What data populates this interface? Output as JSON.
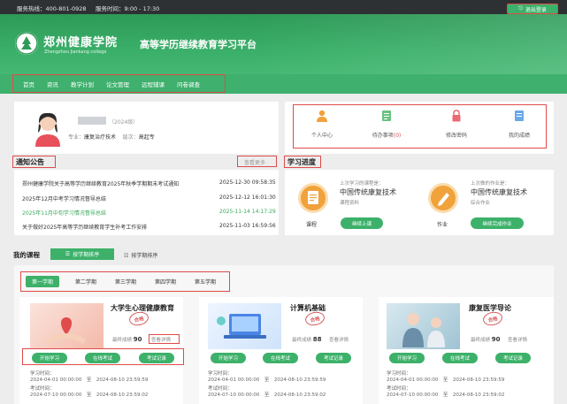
{
  "topbar": {
    "hotline": "服务热线：400-801-0928",
    "service_time": "服务时间：9:00 - 17:30",
    "logout": "退出登录"
  },
  "header": {
    "logo_cn": "郑州健康学院",
    "logo_en": "Zhengzhou Jiankang college",
    "site_title": "高等学历继续教育学习平台"
  },
  "nav": {
    "items": [
      "首页",
      "资讯",
      "教学计划",
      "论文管理",
      "远程辅课",
      "问卷调查"
    ]
  },
  "profile": {
    "grade": "（2024级）",
    "major_label": "专业：",
    "major": "康复治疗技术",
    "level_label": "层次：",
    "level": "高起专"
  },
  "quick_access": [
    {
      "label": "个人中心",
      "icon": "person-icon"
    },
    {
      "label": "待办事项",
      "count": "(0)",
      "icon": "todo-list-icon"
    },
    {
      "label": "修改密码",
      "icon": "lock-icon"
    },
    {
      "label": "我的成绩",
      "icon": "grade-report-icon"
    }
  ],
  "notice": {
    "title": "通知公告",
    "more": "查看更多",
    "items": [
      {
        "text": "郑州健康学院关于高等学历继续教育2025年秋季学期期末考试通知",
        "date": "2025-12-30 09:58:35",
        "highlight": false
      },
      {
        "text": "2025年12月中考学习情况督导总结",
        "date": "2025-12-12 16:01:30",
        "highlight": false
      },
      {
        "text": "2025年11月中旬学习情况督导总结",
        "date": "2025-11-14 14:17:29",
        "highlight": true
      },
      {
        "text": "关于做好2025年高等学历继续教育学生补考工作安排",
        "date": "2025-11-03 16:59:56",
        "highlight": false
      }
    ]
  },
  "progress": {
    "title": "学习进度",
    "course": {
      "last_label": "上次学习的课程是：",
      "name": "中国传统康复技术",
      "sub": "课程资料",
      "circle_label": "课程",
      "button": "继续上课"
    },
    "homework": {
      "last_label": "上次做的作业是：",
      "name": "中国传统康复技术",
      "sub": "综合作业",
      "circle_label": "作业",
      "button": "继续完成作业"
    }
  },
  "my_courses": {
    "title": "我的课程",
    "sort_term": "按学期排序",
    "sort_type": "按学期排序",
    "terms": [
      "第一学期",
      "第二学期",
      "第三学期",
      "第四学期",
      "第五学期"
    ],
    "cards": [
      {
        "title": "大学生心理健康教育",
        "stamp": "合格",
        "score_label": "最终成绩",
        "score": "90",
        "review": "查看详情",
        "buttons": [
          "开始学习",
          "在线考试",
          "考试记录"
        ],
        "study_label": "学习时间：",
        "study": "2024-04-01 00:00:00　至　2024-08-10 23:59:59",
        "exam_label": "考试时间：",
        "exam": "2024-07-10 00:00:00　至　2024-08-10 23:59:02"
      },
      {
        "title": "计算机基础",
        "stamp": "合格",
        "score_label": "最终成绩",
        "score": "88",
        "review": "查看详情",
        "buttons": [
          "开始学习",
          "在线考试",
          "考试记录"
        ],
        "study_label": "学习时间：",
        "study": "2024-04-01 00:00:00　至　2024-08-10 23:59:59",
        "exam_label": "考试时间：",
        "exam": "2024-07-10 00:00:00　至　2024-08-10 23:59:02"
      },
      {
        "title": "康复医学导论",
        "stamp": "合格",
        "score_label": "最终成绩",
        "score": "90",
        "review": "查看详情",
        "buttons": [
          "开始学习",
          "在线考试",
          "考试记录"
        ],
        "study_label": "学习时间：",
        "study": "2024-04-01 00:00:00　至　2024-08-10 23:59:59",
        "exam_label": "考试时间：",
        "exam": "2024-07-10 00:00:00　至　2024-08-10 23:59:02"
      }
    ]
  },
  "colors": {
    "brand_green": "#3db16a",
    "highlight_red": "#e04b4b",
    "progress_orange": "#f0a23b"
  }
}
